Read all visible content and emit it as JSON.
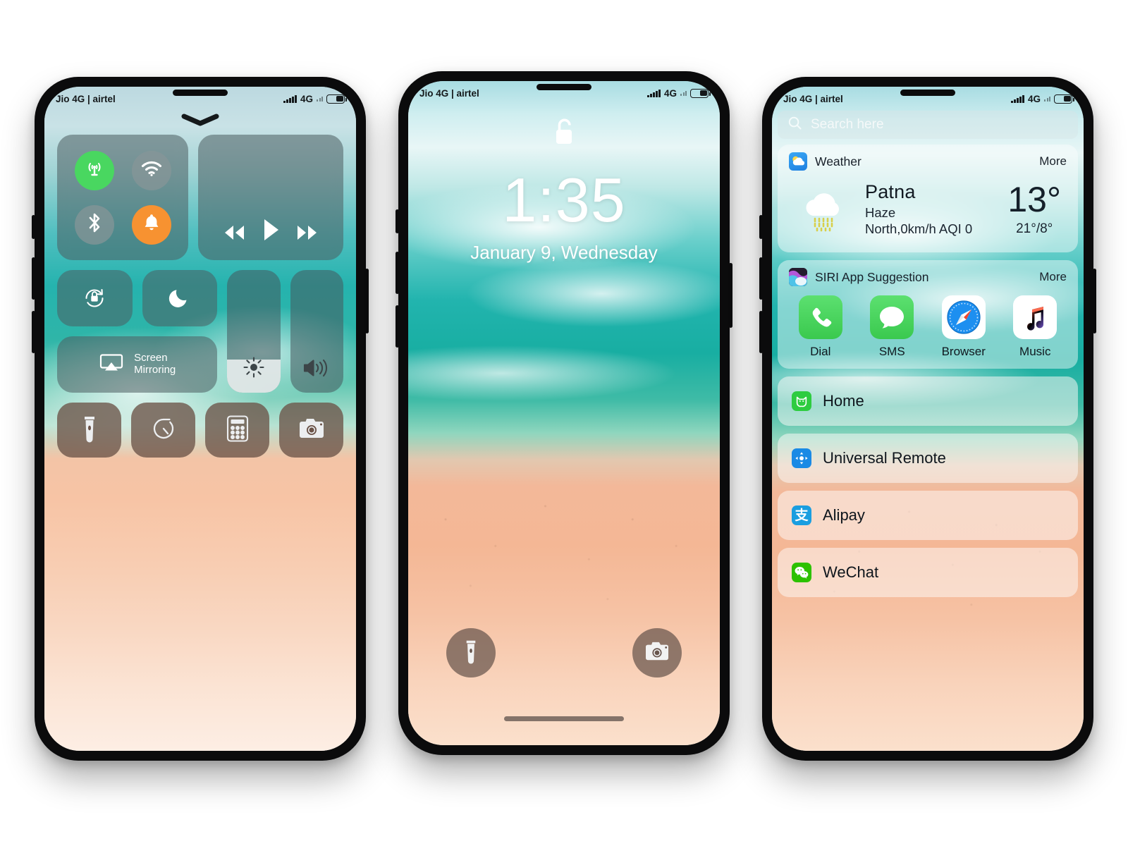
{
  "status_bar": {
    "carrier": "Jio 4G | airtel",
    "network": "4G",
    "signal_icon": "signal-bars-icon",
    "battery_icon": "battery-icon"
  },
  "phone1_control_center": {
    "handle_icon": "chevron-down-icon",
    "connectivity": {
      "cellular": {
        "label": "cellular-data",
        "icon": "cellular-antenna-icon",
        "state": "on",
        "color": "#49d760"
      },
      "wifi": {
        "label": "wifi",
        "icon": "wifi-icon",
        "state": "off",
        "color": "#8a9698"
      },
      "bluetooth": {
        "label": "bluetooth",
        "icon": "bluetooth-icon",
        "state": "off",
        "color": "#8a9698"
      },
      "ringer": {
        "label": "ringer",
        "icon": "bell-icon",
        "state": "on",
        "color": "#f79231"
      }
    },
    "media": {
      "rewind_icon": "rewind-icon",
      "play_icon": "play-icon",
      "forward_icon": "fast-forward-icon"
    },
    "rotation_lock": {
      "icon": "rotation-lock-icon"
    },
    "do_not_disturb": {
      "icon": "moon-icon"
    },
    "screen_mirroring": {
      "label_line1": "Screen",
      "label_line2": "Mirroring",
      "icon": "airplay-icon"
    },
    "brightness": {
      "icon": "brightness-sun-icon",
      "value_percent": 27
    },
    "volume": {
      "icon": "speaker-icon",
      "value_percent": 0
    },
    "utilities": [
      {
        "name": "flashlight",
        "icon": "flashlight-icon"
      },
      {
        "name": "timer",
        "icon": "timer-icon"
      },
      {
        "name": "calculator",
        "icon": "calculator-icon"
      },
      {
        "name": "camera",
        "icon": "camera-icon"
      }
    ]
  },
  "phone2_lock_screen": {
    "lock_icon": "unlocked-padlock-icon",
    "time": "1:35",
    "date": "January 9, Wednesday",
    "flashlight_icon": "flashlight-icon",
    "camera_icon": "camera-icon",
    "home_indicator": "home-indicator"
  },
  "phone3_today_view": {
    "search": {
      "placeholder": "Search here",
      "icon": "search-icon"
    },
    "weather": {
      "title": "Weather",
      "more": "More",
      "app_icon": "weather-app-icon",
      "condition_icon": "haze-cloud-icon",
      "city": "Patna",
      "condition": "Haze",
      "details": "North,0km/h  AQI 0",
      "temperature": "13°",
      "range": "21°/8°"
    },
    "siri": {
      "title": "SIRI App Suggestion",
      "more": "More",
      "app_icon": "siri-icon",
      "apps": [
        {
          "label": "Dial",
          "icon": "phone-icon",
          "color": "#4cd964"
        },
        {
          "label": "SMS",
          "icon": "message-bubble-icon",
          "color": "#4cd964"
        },
        {
          "label": "Browser",
          "icon": "safari-compass-icon",
          "color": "#1d8ff0"
        },
        {
          "label": "Music",
          "icon": "music-note-icon",
          "color": "#ffffff"
        }
      ]
    },
    "shortcuts": [
      {
        "label": "Home",
        "icon": "home-app-icon",
        "color": "#2ecc40"
      },
      {
        "label": "Universal Remote",
        "icon": "universal-remote-icon",
        "color": "#1a8ae5"
      },
      {
        "label": "Alipay",
        "icon": "alipay-icon",
        "color": "#1a9ee0"
      },
      {
        "label": "WeChat",
        "icon": "wechat-icon",
        "color": "#2dc100"
      }
    ]
  }
}
